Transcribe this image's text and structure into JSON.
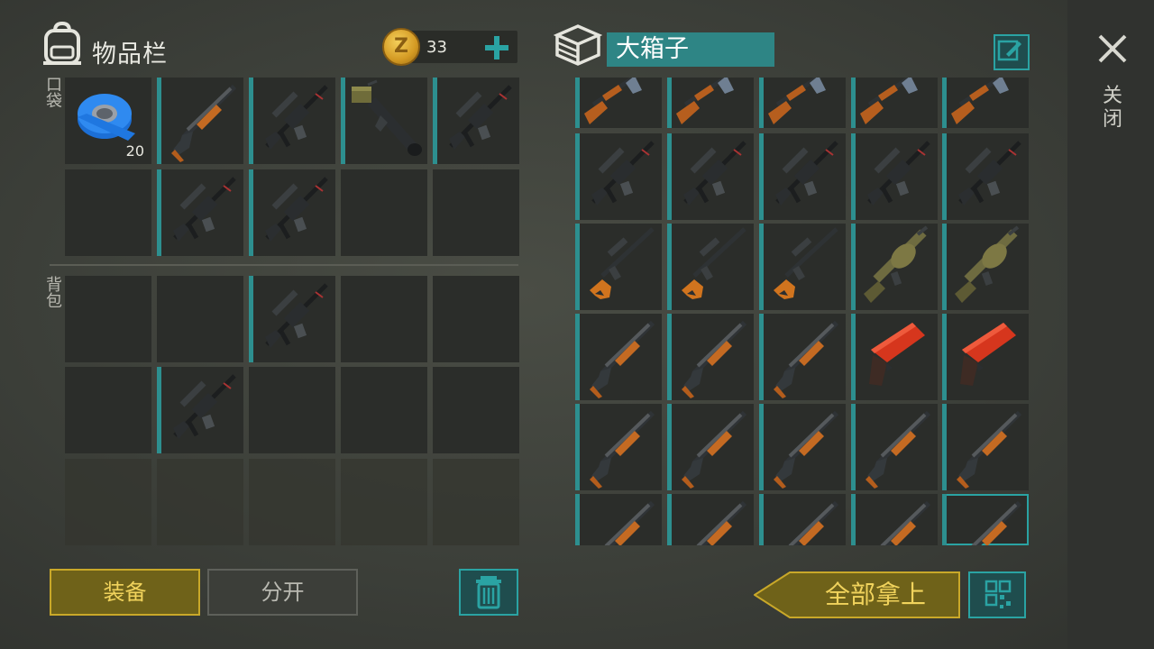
{
  "inventory": {
    "title": "物品栏",
    "coins": "33",
    "add_icon": "plus-icon",
    "pocket_label": "口袋",
    "backpack_label": "背包",
    "tape_count": "20"
  },
  "container": {
    "name": "大箱子",
    "take_all_label": "全部拿上"
  },
  "buttons": {
    "equip": "装备",
    "split": "分开"
  },
  "side": {
    "close_label": "关闭"
  },
  "colors": {
    "accent_teal": "#2aa3a3",
    "gold": "#c9a829",
    "slot_bg": "#2b2d2a"
  },
  "icons": [
    "backpack-icon",
    "coin-icon",
    "plus-icon",
    "chest-icon",
    "edit-icon",
    "trash-icon",
    "grid-icon",
    "close-icon"
  ]
}
